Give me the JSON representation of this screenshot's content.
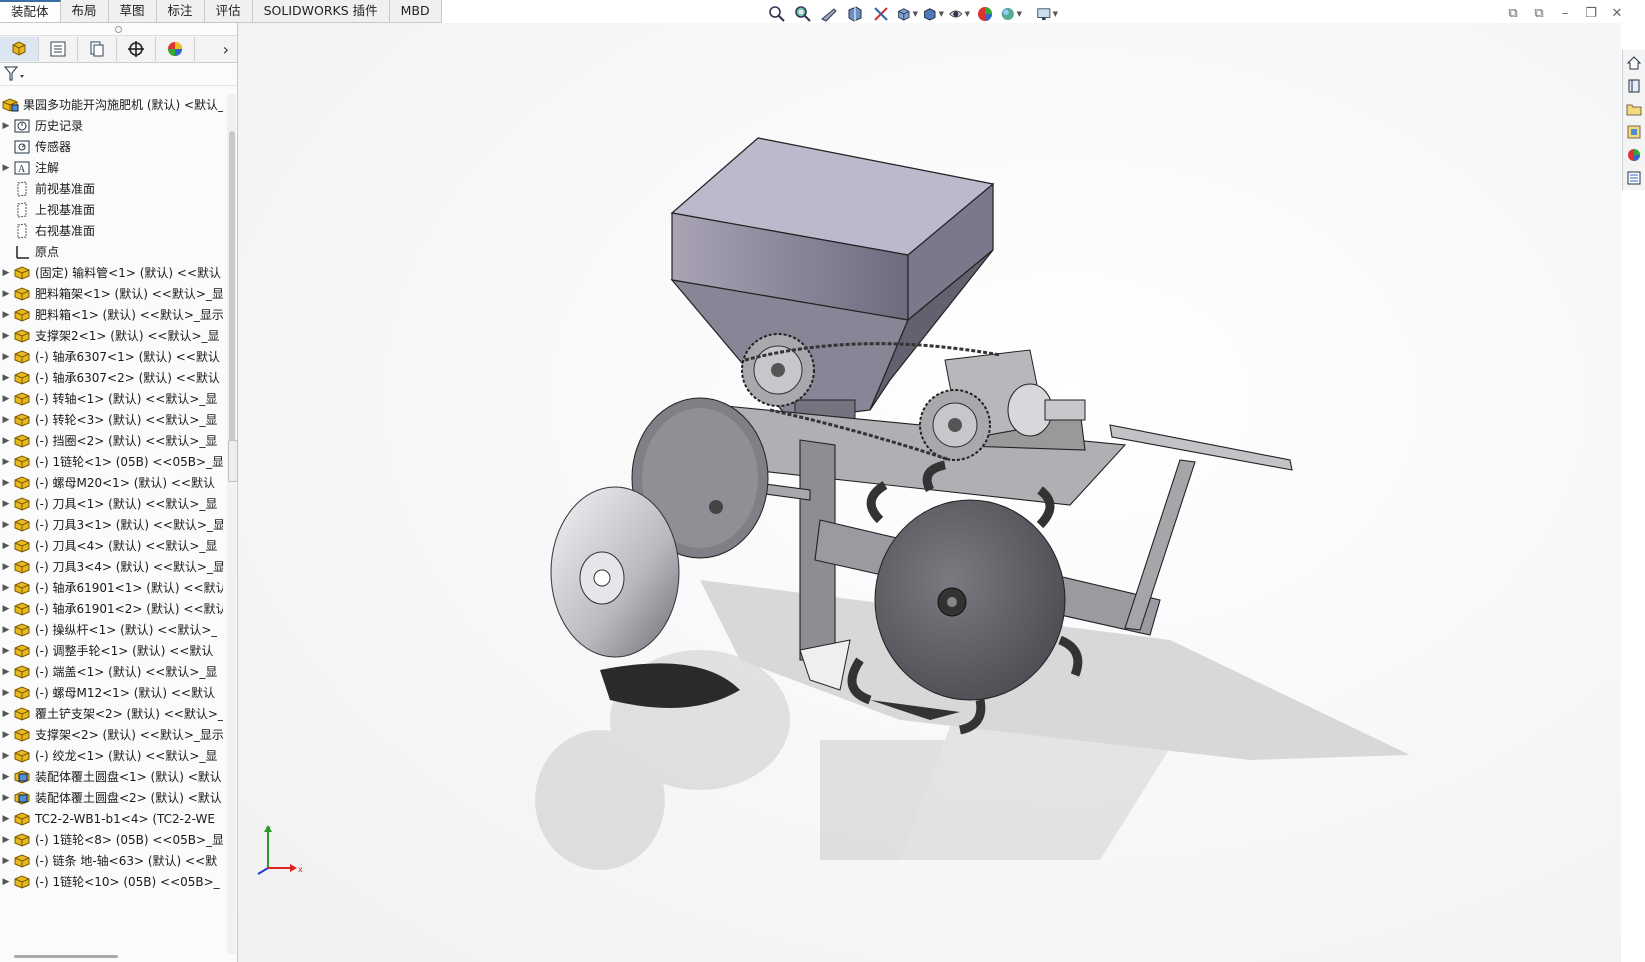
{
  "command_tabs": [
    "装配体",
    "布局",
    "草图",
    "标注",
    "评估",
    "SOLIDWORKS 插件",
    "MBD"
  ],
  "active_tab": "装配体",
  "hud_icons": [
    "zoom-to-fit-icon",
    "zoom-area-icon",
    "previous-view-icon",
    "section-view-icon",
    "dynamic-annotation-icon",
    "view-orientation-icon",
    "display-style-icon",
    "hide-show-icon",
    "edit-appearance-icon",
    "apply-scene-icon",
    "view-settings-icon"
  ],
  "panel_tabs": [
    "feature-manager-icon",
    "property-manager-icon",
    "configuration-manager-icon",
    "dimxpert-icon",
    "display-manager-icon"
  ],
  "tree": {
    "root": "果园多功能开沟施肥机 (默认) <默认_",
    "items": [
      {
        "label": "历史记录",
        "icon": "history-icon",
        "expand": true
      },
      {
        "label": "传感器",
        "icon": "sensor-icon",
        "expand": false
      },
      {
        "label": "注解",
        "icon": "annotation-icon",
        "expand": true
      },
      {
        "label": "前视基准面",
        "icon": "plane-icon",
        "expand": false
      },
      {
        "label": "上视基准面",
        "icon": "plane-icon",
        "expand": false
      },
      {
        "label": "右视基准面",
        "icon": "plane-icon",
        "expand": false
      },
      {
        "label": "原点",
        "icon": "origin-icon",
        "expand": false
      },
      {
        "label": "(固定) 输料管<1> (默认) <<默认",
        "icon": "part-icon",
        "expand": true
      },
      {
        "label": "肥料箱架<1> (默认) <<默认>_显",
        "icon": "part-icon",
        "expand": true
      },
      {
        "label": "肥料箱<1> (默认) <<默认>_显示",
        "icon": "part-icon",
        "expand": true
      },
      {
        "label": "支撑架2<1> (默认) <<默认>_显",
        "icon": "part-icon",
        "expand": true
      },
      {
        "label": "(-) 轴承6307<1> (默认) <<默认",
        "icon": "part-icon",
        "expand": true
      },
      {
        "label": "(-) 轴承6307<2> (默认) <<默认",
        "icon": "part-icon",
        "expand": true
      },
      {
        "label": "(-) 转轴<1> (默认) <<默认>_显",
        "icon": "part-icon",
        "expand": true
      },
      {
        "label": "(-) 转轮<3> (默认) <<默认>_显",
        "icon": "part-icon",
        "expand": true
      },
      {
        "label": "(-) 挡圈<2> (默认) <<默认>_显",
        "icon": "part-icon",
        "expand": true
      },
      {
        "label": "(-) 1链轮<1> (05B) <<05B>_显",
        "icon": "part-icon",
        "expand": true
      },
      {
        "label": "(-) 螺母M20<1> (默认) <<默认",
        "icon": "part-icon",
        "expand": true
      },
      {
        "label": "(-) 刀具<1> (默认) <<默认>_显",
        "icon": "part-icon",
        "expand": true
      },
      {
        "label": "(-) 刀具3<1> (默认) <<默认>_显",
        "icon": "part-icon",
        "expand": true
      },
      {
        "label": "(-) 刀具<4> (默认) <<默认>_显",
        "icon": "part-icon",
        "expand": true
      },
      {
        "label": "(-) 刀具3<4> (默认) <<默认>_显",
        "icon": "part-icon",
        "expand": true
      },
      {
        "label": "(-) 轴承61901<1> (默认) <<默认",
        "icon": "part-icon",
        "expand": true
      },
      {
        "label": "(-) 轴承61901<2> (默认) <<默认",
        "icon": "part-icon",
        "expand": true
      },
      {
        "label": "(-) 操纵杆<1> (默认) <<默认>_",
        "icon": "part-icon",
        "expand": true
      },
      {
        "label": "(-) 调整手轮<1> (默认) <<默认",
        "icon": "part-icon",
        "expand": true
      },
      {
        "label": "(-) 端盖<1> (默认) <<默认>_显",
        "icon": "part-icon",
        "expand": true
      },
      {
        "label": "(-) 螺母M12<1> (默认) <<默认",
        "icon": "part-icon",
        "expand": true
      },
      {
        "label": "覆土铲支架<2> (默认) <<默认>_",
        "icon": "part-icon",
        "expand": true
      },
      {
        "label": "支撑架<2> (默认) <<默认>_显示",
        "icon": "part-icon",
        "expand": true
      },
      {
        "label": "(-) 绞龙<1> (默认) <<默认>_显",
        "icon": "part-icon",
        "expand": true
      },
      {
        "label": "装配体覆土圆盘<1> (默认) <默认",
        "icon": "subassembly-icon",
        "expand": true
      },
      {
        "label": "装配体覆土圆盘<2> (默认) <默认",
        "icon": "subassembly-icon",
        "expand": true
      },
      {
        "label": "TC2-2-WB1-b1<4> (TC2-2-WE",
        "icon": "part-icon",
        "expand": true
      },
      {
        "label": "(-) 1链轮<8> (05B) <<05B>_显",
        "icon": "part-icon",
        "expand": true
      },
      {
        "label": "(-) 链条 地-轴<63> (默认) <<默",
        "icon": "part-icon",
        "expand": true
      },
      {
        "label": "(-) 1链轮<10> (05B) <<05B>_",
        "icon": "part-icon",
        "expand": true
      }
    ]
  },
  "task_pane": [
    "home-icon",
    "resources-icon",
    "file-explorer-icon",
    "design-library-icon",
    "appearances-icon",
    "custom-properties-icon"
  ],
  "triad": {
    "x_label": "x",
    "y_label": "y"
  },
  "colors": {
    "accent": "#3a6ea5",
    "part_yellow": "#e8b820",
    "hopper": "#8e8aa0",
    "metal": "#8f8f94"
  }
}
